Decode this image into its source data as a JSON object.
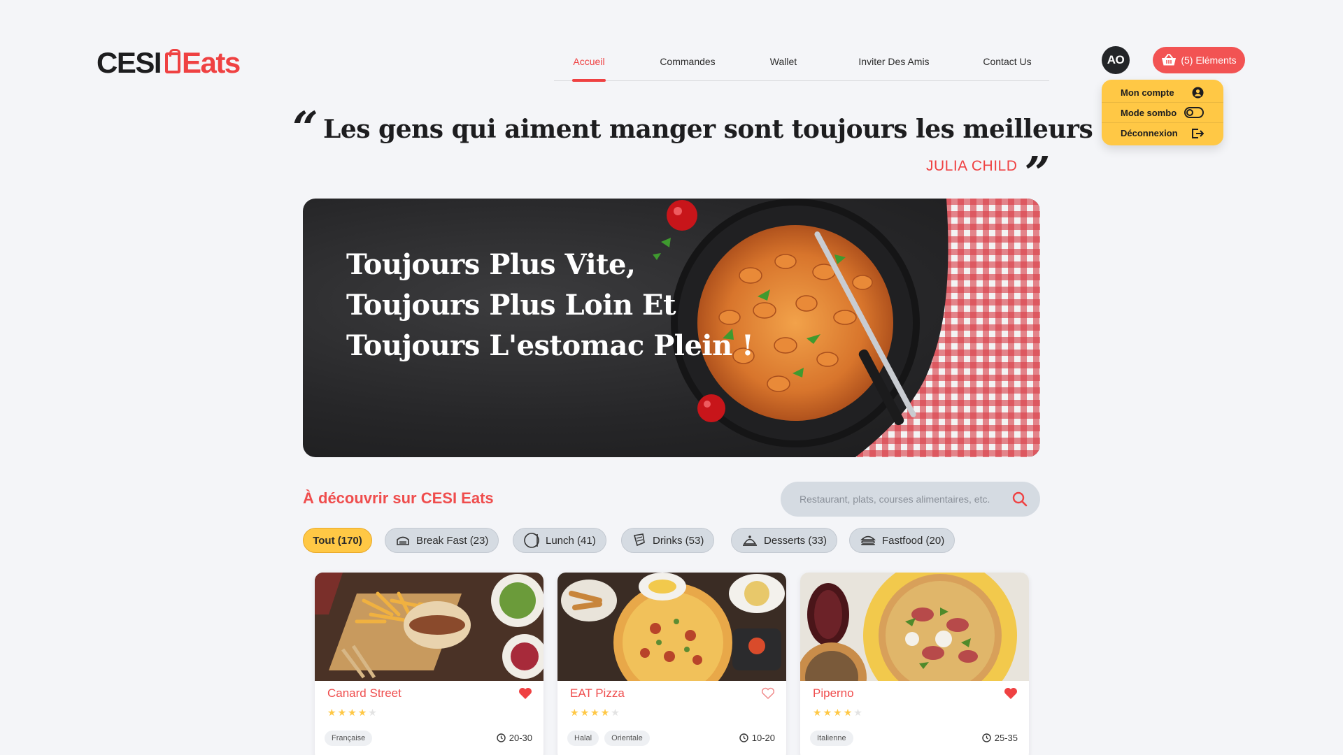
{
  "brand": {
    "part1": "CESI",
    "part2": "Eats"
  },
  "nav": {
    "items": [
      {
        "label": "Accueil",
        "active": true
      },
      {
        "label": "Commandes",
        "active": false
      },
      {
        "label": "Wallet",
        "active": false
      },
      {
        "label": "Inviter Des Amis",
        "active": false
      },
      {
        "label": "Contact Us",
        "active": false
      }
    ]
  },
  "user": {
    "initials": "AO",
    "cart_label": "(5) Eléments",
    "menu": [
      {
        "label": "Mon compte",
        "icon": "user-circle-icon"
      },
      {
        "label": "Mode sombo",
        "icon": "toggle-icon"
      },
      {
        "label": "Déconnexion",
        "icon": "logout-icon"
      }
    ]
  },
  "quote": {
    "open_mark": "“",
    "text": "Les gens qui aiment manger sont toujours les meilleurs",
    "close_mark": "„",
    "author": "JULIA CHILD"
  },
  "hero": {
    "lines": [
      "Toujours Plus Vite,",
      "Toujours Plus Loin Et",
      "Toujours L'estomac Plein !"
    ]
  },
  "discover": {
    "title": "À découvrir sur CESI Eats",
    "search_placeholder": "Restaurant, plats, courses alimentaires, etc."
  },
  "categories": [
    {
      "label": "Tout (170)",
      "icon": "",
      "active": true
    },
    {
      "label": "Break Fast (23)",
      "icon": "breakfast-icon",
      "active": false
    },
    {
      "label": "Lunch (41)",
      "icon": "lunch-icon",
      "active": false
    },
    {
      "label": "Drinks (53)",
      "icon": "drinks-icon",
      "active": false
    },
    {
      "label": "Desserts (33)",
      "icon": "desserts-icon",
      "active": false
    },
    {
      "label": "Fastfood (20)",
      "icon": "fastfood-icon",
      "active": false
    }
  ],
  "restaurants": [
    {
      "name": "Canard Street",
      "rating": 4,
      "favorite": true,
      "tags": [
        "Française"
      ],
      "time": "20-30"
    },
    {
      "name": "EAT Pizza",
      "rating": 4,
      "favorite": false,
      "tags": [
        "Halal",
        "Orientale"
      ],
      "time": "10-20"
    },
    {
      "name": "Piperno",
      "rating": 4,
      "favorite": true,
      "tags": [
        "Italienne"
      ],
      "time": "25-35"
    }
  ],
  "colors": {
    "accent": "#ef4142",
    "yellow": "#ffc845",
    "chip_bg": "#d5dbe2",
    "star": "#ffc845"
  }
}
